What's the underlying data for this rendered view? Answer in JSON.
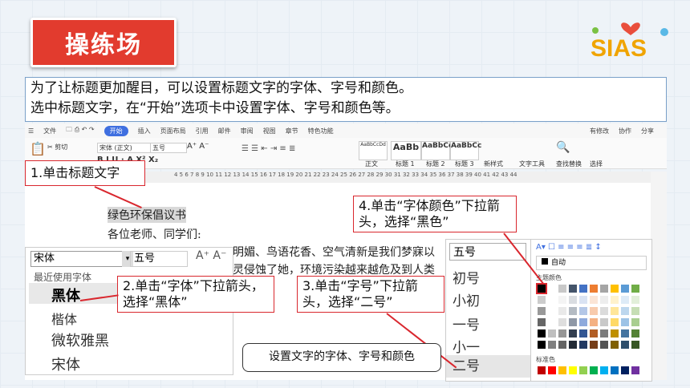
{
  "slide_title": "操练场",
  "logo_text": "SIAS",
  "intro": {
    "line1": "为了让标题更加醒目，可以设置标题文字的字体、字号和颜色。",
    "line2": "选中标题文字，在“开始”选项卡中设置字体、字号和颜色等。"
  },
  "menubar": {
    "items": [
      "文件",
      "开始",
      "插入",
      "页面布局",
      "引用",
      "邮件",
      "审阅",
      "视图",
      "章节",
      "特色功能"
    ],
    "right": [
      "有修改",
      "协作",
      "分享"
    ]
  },
  "ribbon": {
    "cut": "剪切",
    "font_name": "宋体 (正文)",
    "font_size": "五号",
    "styles": [
      {
        "preview": "AaBbCcDd",
        "label": "正文"
      },
      {
        "preview": "AaBb",
        "label": "标题 1"
      },
      {
        "preview": "AaBbCc",
        "label": "标题 2"
      },
      {
        "preview": "AaBbCc",
        "label": "标题 3"
      }
    ],
    "new_style": "新样式",
    "text_tools": "文字工具",
    "find_replace": "查找替换",
    "select": "选择"
  },
  "ruler": "4  5  6  7  8  9  10  11  12  13  14  15  16  17  18  19  20  21  22  23  24  25  26  27  28  29  30  31  32  33  34  35  36  37  38  39  40  41  42  43  44",
  "document": {
    "heading": "绿色环保倡议书",
    "greeting": "各位老师、同学们:",
    "line1": "明媚、鸟语花香、空气清新是我们梦寐以",
    "line2": "灵侵蚀了她，环境污染越来越危及到人类"
  },
  "callouts": {
    "step1": "1.单击标题文字",
    "step2": "2.单击“字体”下拉箭头，选择“黑体”",
    "step3": "3.单击“字号”下拉箭头，选择“二号”",
    "step4": "4.单击“字体颜色”下拉箭头，选择“黑色”"
  },
  "font_panel": {
    "current_font": "宋体",
    "current_size": "五号",
    "recent_label": "最近使用字体",
    "fonts": [
      "黑体",
      "楷体",
      "微软雅黑",
      "宋体"
    ]
  },
  "size_panel": {
    "current": "五号",
    "sizes": [
      "初号",
      "小初",
      "一号",
      "小一",
      "二号"
    ]
  },
  "color_panel": {
    "auto_label": "自动",
    "theme_label": "主题颜色",
    "standard_label": "标准色",
    "theme_top": [
      "#000000",
      "#ffffff",
      "#c8c8c8",
      "#44546a",
      "#4472c4",
      "#ed7d31",
      "#a5a5a5",
      "#ffc000",
      "#5b9bd5",
      "#70ad47"
    ],
    "standard": [
      "#c00000",
      "#ff0000",
      "#ffc000",
      "#ffff00",
      "#92d050",
      "#00b050",
      "#00b0f0",
      "#0070c0",
      "#002060",
      "#7030a0"
    ]
  },
  "bubble": "设置文字的字体、字号和颜色",
  "colors": {
    "accent_red": "#e23b2e",
    "callout_border": "#d9272e",
    "tab_blue": "#3f6fe0"
  }
}
